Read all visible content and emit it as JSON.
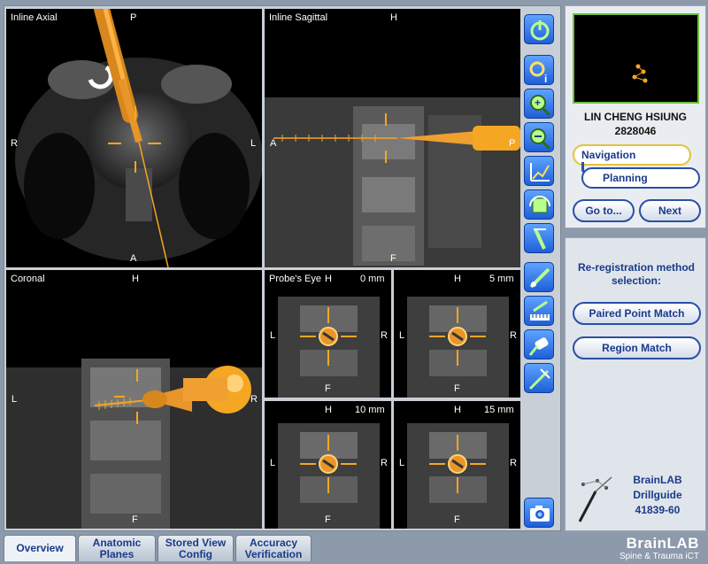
{
  "views": {
    "axial": {
      "title": "Inline Axial",
      "top": "P",
      "left": "R",
      "right": "L",
      "bottom": "A"
    },
    "sagittal": {
      "title": "Inline Sagittal",
      "top": "H",
      "left": "A",
      "right": "P",
      "bottom": "F"
    },
    "coronal": {
      "title": "Coronal",
      "top": "H",
      "left": "L",
      "right": "R",
      "bottom": "F"
    },
    "probes_eye": {
      "title": "Probe's Eye",
      "cells": [
        {
          "top": "H",
          "depth": "0 mm",
          "left": "L",
          "right": "R",
          "bottom": "F"
        },
        {
          "top": "H",
          "depth": "5 mm",
          "left": "L",
          "right": "R",
          "bottom": "F"
        },
        {
          "top": "H",
          "depth": "10 mm",
          "left": "L",
          "right": "R",
          "bottom": "F"
        },
        {
          "top": "H",
          "depth": "15 mm",
          "left": "L",
          "right": "R",
          "bottom": "F"
        }
      ]
    }
  },
  "toolbar": [
    {
      "icon": "power-icon"
    },
    {
      "icon": "settings-info-icon"
    },
    {
      "icon": "zoom-in-icon"
    },
    {
      "icon": "zoom-out-icon"
    },
    {
      "icon": "window-level-icon"
    },
    {
      "icon": "rotate-view-icon"
    },
    {
      "icon": "trajectory-icon"
    },
    {
      "icon": "probe-tool-icon"
    },
    {
      "icon": "measure-icon"
    },
    {
      "icon": "instrument-icon"
    },
    {
      "icon": "pointer-tool-icon"
    },
    {
      "icon": "camera-icon"
    }
  ],
  "patient": {
    "name": "LIN  CHENG HSIUNG",
    "id": "2828046"
  },
  "workflow": {
    "navigation": "Navigation",
    "planning": "Planning",
    "goto": "Go to...",
    "next": "Next"
  },
  "reregistration": {
    "title": "Re-registration method selection:",
    "paired": "Paired Point Match",
    "region": "Region Match"
  },
  "instrument": {
    "brand": "BrainLAB",
    "name": "Drillguide",
    "id": "41839-60"
  },
  "tabs": [
    {
      "label": "Overview",
      "active": true
    },
    {
      "label": "Anatomic Planes"
    },
    {
      "label": "Stored View Config"
    },
    {
      "label": "Accuracy Verification"
    }
  ],
  "branding": {
    "logo": "BrainLAB",
    "product": "Spine & Trauma iCT"
  },
  "colors": {
    "accent": "#f5a623",
    "button_blue": "#2a6ee8",
    "text_blue": "#1a3a8a"
  }
}
